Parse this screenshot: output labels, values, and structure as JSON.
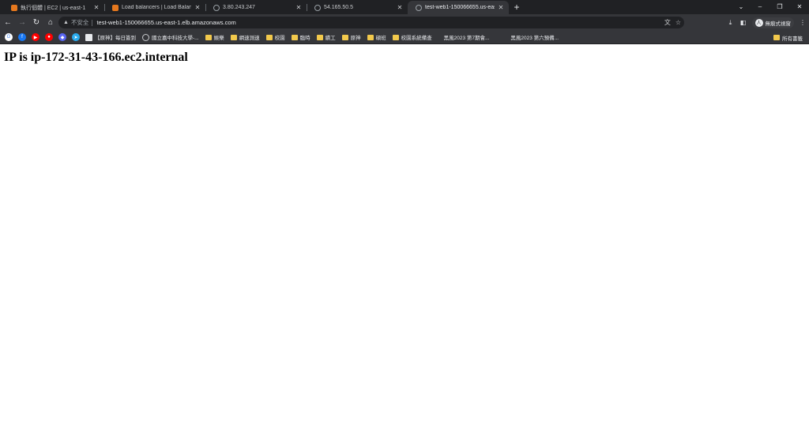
{
  "browser": {
    "tabs": [
      {
        "title": "執行個體 | EC2 | us-east-1",
        "favicon": "aws-icon",
        "active": false
      },
      {
        "title": "Load balancers | Load Balancin",
        "favicon": "aws-icon",
        "active": false
      },
      {
        "title": "3.80.243.247",
        "favicon": "globe-icon",
        "active": false
      },
      {
        "title": "54.165.50.5",
        "favicon": "globe-icon",
        "active": false
      },
      {
        "title": "test-web1-150066655.us-east",
        "favicon": "globe-icon",
        "active": true
      }
    ],
    "close_glyph": "✕",
    "new_tab_glyph": "+",
    "window_controls": {
      "dropdown": "⌄",
      "minimize": "–",
      "restore": "❐",
      "close": "✕"
    },
    "toolbar": {
      "back": "←",
      "forward": "→",
      "reload": "↻",
      "home": "⌂",
      "security_icon": "▲",
      "security_label": "不安全",
      "url": "test-web1-150066655.us-east-1.elb.amazonaws.com",
      "translate_icon": "文",
      "star_icon": "☆",
      "download_icon": "⤓",
      "sidepanel_icon": "◧",
      "profile_initial": "人",
      "profile_label": "無痕式視窗",
      "menu_icon": "⋮"
    },
    "bookmarks": [
      {
        "type": "icon",
        "name": "google-icon",
        "glyph": "G",
        "color": "#ffffff",
        "text_color": "#4285f4"
      },
      {
        "type": "icon",
        "name": "facebook-icon",
        "glyph": "f",
        "color": "#1877f2",
        "text_color": "#ffffff"
      },
      {
        "type": "icon",
        "name": "youtube-icon",
        "glyph": "▶",
        "color": "#ff0000",
        "text_color": "#ffffff"
      },
      {
        "type": "icon",
        "name": "youtube-music-icon",
        "glyph": "●",
        "color": "#ff0000",
        "text_color": "#ffffff"
      },
      {
        "type": "icon",
        "name": "discord-icon",
        "glyph": "◆",
        "color": "#5865f2",
        "text_color": "#ffffff"
      },
      {
        "type": "icon",
        "name": "telegram-icon",
        "glyph": "➤",
        "color": "#2aabee",
        "text_color": "#ffffff"
      },
      {
        "type": "link",
        "label": "【原神】每日簽到",
        "icon": "hoyolab-icon"
      },
      {
        "type": "link",
        "label": "國立嘉中科技大學-...",
        "icon": "globe-icon"
      },
      {
        "type": "folder",
        "label": "娛樂"
      },
      {
        "type": "folder",
        "label": "網速測速"
      },
      {
        "type": "folder",
        "label": "校園"
      },
      {
        "type": "folder",
        "label": "臨時"
      },
      {
        "type": "folder",
        "label": "績工"
      },
      {
        "type": "folder",
        "label": "原神"
      },
      {
        "type": "folder",
        "label": "碩班"
      },
      {
        "type": "folder",
        "label": "校園系統備查"
      },
      {
        "type": "link",
        "label": "黑風2023 第7期會...",
        "icon": "blank-icon"
      },
      {
        "type": "link",
        "label": "黑風2023 第六預備...",
        "icon": "blank-icon"
      }
    ],
    "bookmarks_right": {
      "label": "所有書籤"
    }
  },
  "page": {
    "heading": "IP is ip-172-31-43-166.ec2.internal"
  }
}
